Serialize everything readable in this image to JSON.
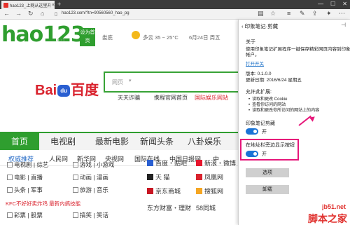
{
  "browser": {
    "tab_title": "hao123_上网从这里开始",
    "tab_close": "×",
    "new_tab": "+",
    "url": "hao123.com/?tn=90560560_hao_pg",
    "window_controls": [
      "—",
      "☐",
      "✕"
    ]
  },
  "page": {
    "logo": "hao123",
    "logo_sub": ".com",
    "badge": "设为首页",
    "weather_city": "娄底",
    "weather_temp": "多云 35 ~ 25°C",
    "date": "6月24日 周五",
    "baidu_a": "Bai",
    "baidu_paw": "du",
    "baidu_b": "百度",
    "search_tab": "网页",
    "search_dropdown": "▾",
    "links": [
      "天天诈骗",
      "携程官网首页",
      "国际娱乐网站"
    ],
    "categories": [
      "首页",
      "电视剧",
      "最新电影",
      "新闻头条",
      "八卦娱乐"
    ],
    "quick_links": [
      "权威推荐",
      "人民网",
      "新华网",
      "央视网",
      "国际在线",
      "中国日报网",
      "中"
    ],
    "left_rows": [
      [
        "电视剧 | 综艺",
        "游戏 | 小游戏"
      ],
      [
        "电影 | 直播",
        "动画 | 漫画"
      ],
      [
        "头条 | 军事",
        "旅游 | 音乐"
      ],
      [
        "彩票 | 股票",
        "搞笑 | 笑话"
      ]
    ],
    "promo": "KFC不好好卖炸鸡 最新内搞技能",
    "right_rows": [
      [
        "百度・贴吧",
        "新浪・微博"
      ],
      [
        "天 猫",
        "凤凰网"
      ],
      [
        "京东商城",
        "搜狐网"
      ],
      [
        "东方财富・理财",
        "58同城"
      ]
    ]
  },
  "panel": {
    "title": "印象笔记·剪藏",
    "pin": "⊣",
    "about": "关于",
    "desc1": "使用印象笔记扩展程序一键保存精彩网页内容到印象笔记",
    "desc2": "帐户。",
    "open_link": "打开开关",
    "version": "版本: 0.1.0.0",
    "updated": "更新日期: 2016/6/24 星期五",
    "perms": "允许此扩展:",
    "bullets": [
      "读取和更改 Cookie",
      "查看你访问的网站",
      "读取和更改你所访问的网站上的内容"
    ],
    "toggle1_label": "印象笔记剪藏",
    "toggle1_state": "开",
    "toggle2_label": "在地址栏旁边显示按钮",
    "toggle2_state": "开",
    "options_button": "选项",
    "uninstall_button": "卸载"
  },
  "watermark": {
    "line1": "jb51.net",
    "line2": "脚本之家"
  },
  "colors": {
    "hao_green": "#2f9e2f",
    "baidu_red": "#d9232e",
    "baidu_blue": "#2a5fd1",
    "toggle_blue": "#1a73d6",
    "highlight_pink": "#e6177a"
  }
}
